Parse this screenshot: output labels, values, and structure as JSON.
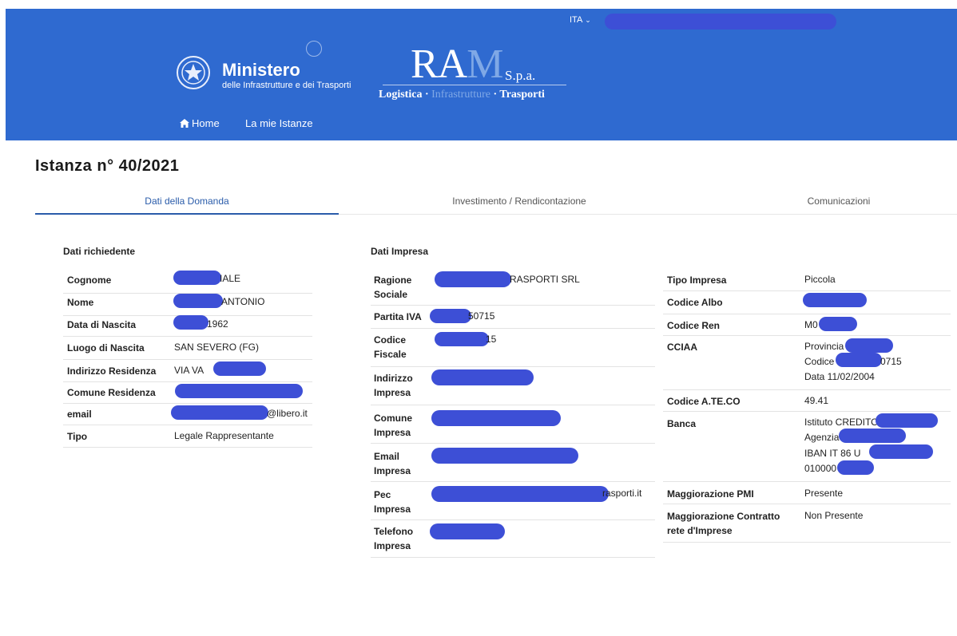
{
  "topbar": {
    "language": "ITA",
    "language_chevron": "⌄"
  },
  "header": {
    "ministry_title": "Ministero",
    "ministry_subtitle": "delle Infrastrutture e dei Trasporti",
    "ram_logo": {
      "big": "RA",
      "m": "M",
      "spa": "S.p.a.",
      "tag_left": "Logistica · ",
      "tag_mid": "Infrastrutture",
      "tag_right": " · Trasporti"
    },
    "nav": {
      "home_icon": "home-icon",
      "home": "Home",
      "istanze": "La mie Istanze"
    }
  },
  "page": {
    "title": "Istanza n° 40/2021"
  },
  "tabs": [
    "Dati della Domanda",
    "Investimento / Rendicontazione",
    "Comunicazioni"
  ],
  "richiedente": {
    "heading": "Dati richiedente",
    "rows": [
      {
        "label": "Cognome",
        "value": "IALE"
      },
      {
        "label": "Nome",
        "value": "ANTONIO"
      },
      {
        "label": "Data di Nascita",
        "value": "1962"
      },
      {
        "label": "Luogo di Nascita",
        "value": "SAN SEVERO (FG)"
      },
      {
        "label": "Indirizzo Residenza",
        "value": "VIA VA"
      },
      {
        "label": "Comune Residenza",
        "value": ""
      },
      {
        "label": "email",
        "value": "@libero.it"
      },
      {
        "label": "Tipo",
        "value": "Legale Rappresentante"
      }
    ]
  },
  "impresa": {
    "heading": "Dati Impresa",
    "rows": [
      {
        "label": "Ragione Sociale",
        "value": "RASPORTI SRL"
      },
      {
        "label": "Partita IVA",
        "value": "50715"
      },
      {
        "label": "Codice Fiscale",
        "value": "15"
      },
      {
        "label": "Indirizzo Impresa",
        "value": ""
      },
      {
        "label": "Comune Impresa",
        "value": ""
      },
      {
        "label": "Email Impresa",
        "value": ""
      },
      {
        "label": "Pec Impresa",
        "value": "rasporti.it"
      },
      {
        "label": "Telefono Impresa",
        "value": ""
      }
    ]
  },
  "impresa2": {
    "rows": [
      {
        "label": "Tipo Impresa",
        "value": "Piccola"
      },
      {
        "label": "Codice Albo",
        "value": ""
      },
      {
        "label": "Codice Ren",
        "value": "M0"
      },
      {
        "label": "CCIAA",
        "line1": "Provincia",
        "line2": "Codice",
        "line2b": "0715",
        "line3": "Data 11/02/2004"
      },
      {
        "label": "Codice A.TE.CO",
        "value": "49.41"
      },
      {
        "label": "Banca",
        "line1": "Istituto CREDITO",
        "line2": "Agenzia",
        "line3": "IBAN IT 86 U",
        "line4": "010000"
      },
      {
        "label": "Maggiorazione PMI",
        "value": "Presente"
      },
      {
        "label": "Maggiorazione Contratto rete d'Imprese",
        "value": "Non Presente"
      }
    ]
  },
  "colors": {
    "header_bg": "#2f6ad0",
    "redaction": "#3d4fd6",
    "tab_active": "#2a5caa"
  }
}
